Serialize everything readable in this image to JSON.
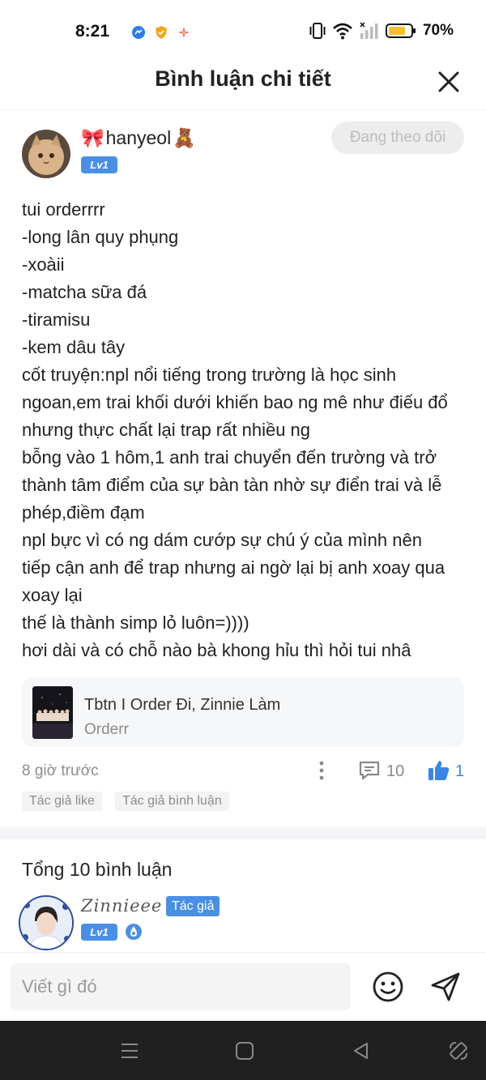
{
  "status": {
    "time": "8:21",
    "battery": "70%"
  },
  "header": {
    "title": "Bình luận chi tiết"
  },
  "post": {
    "author": {
      "name": "hanyeol",
      "level": "Lv1",
      "follow_label": "Đang theo dõi"
    },
    "lines": [
      "tui orderrrr",
      "-long lân quy phụng",
      "-xoàii",
      "-matcha sữa đá",
      "-tiramisu",
      "-kem dâu tây",
      "cốt truyện:npl nổi tiếng trong trường là học sinh",
      "ngoan,em trai khối dưới khiến bao ng mê như điếu đổ",
      "nhưng thực chất lại trap rất nhiều ng",
      "bỗng vào 1 hôm,1 anh trai chuyển đến trường và trở",
      "thành tâm điểm của sự bàn tàn nhờ sự điển trai và lễ",
      "phép,điềm đạm",
      "npl bực vì có ng dám cướp sự chú ý của mình nên",
      "tiếp cận anh để trap nhưng ai ngờ lại bị anh xoay qua",
      "xoay lại",
      "thế là thành simp lỏ luôn=))))",
      "hơi dài và có chỗ nào bà khong hỉu thì hỏi tui nhâ"
    ],
    "story": {
      "title": "Tbtn I Order Đi, Zinnie Làm",
      "subtitle": "Orderr"
    },
    "time_ago": "8 giờ trước",
    "comment_count": "10",
    "like_count": "1",
    "tags": [
      "Tác giả like",
      "Tác giả bình luận"
    ]
  },
  "comments": {
    "total_label": "Tổng 10 bình luận",
    "first": {
      "name": "Zinnieee",
      "author_badge": "Tác giả",
      "level": "Lv1"
    }
  },
  "input": {
    "placeholder": "Viết gì đó"
  },
  "icons": {
    "status_left": [
      "messenger-icon",
      "shield-icon",
      "sparkle-icon"
    ],
    "status_right": [
      "vibrate-icon",
      "wifi-icon",
      "signal-icon",
      "battery-icon"
    ],
    "header": "close-icon",
    "meta": [
      "more-vertical-icon",
      "comment-icon",
      "thumbs-up-icon"
    ],
    "input": [
      "emoji-icon",
      "send-icon"
    ],
    "nav": [
      "menu-icon",
      "home-icon",
      "back-icon",
      "rotate-icon"
    ]
  },
  "colors": {
    "accent": "#4a8fe6",
    "like": "#3a86e8",
    "nav_bg": "#202020"
  }
}
